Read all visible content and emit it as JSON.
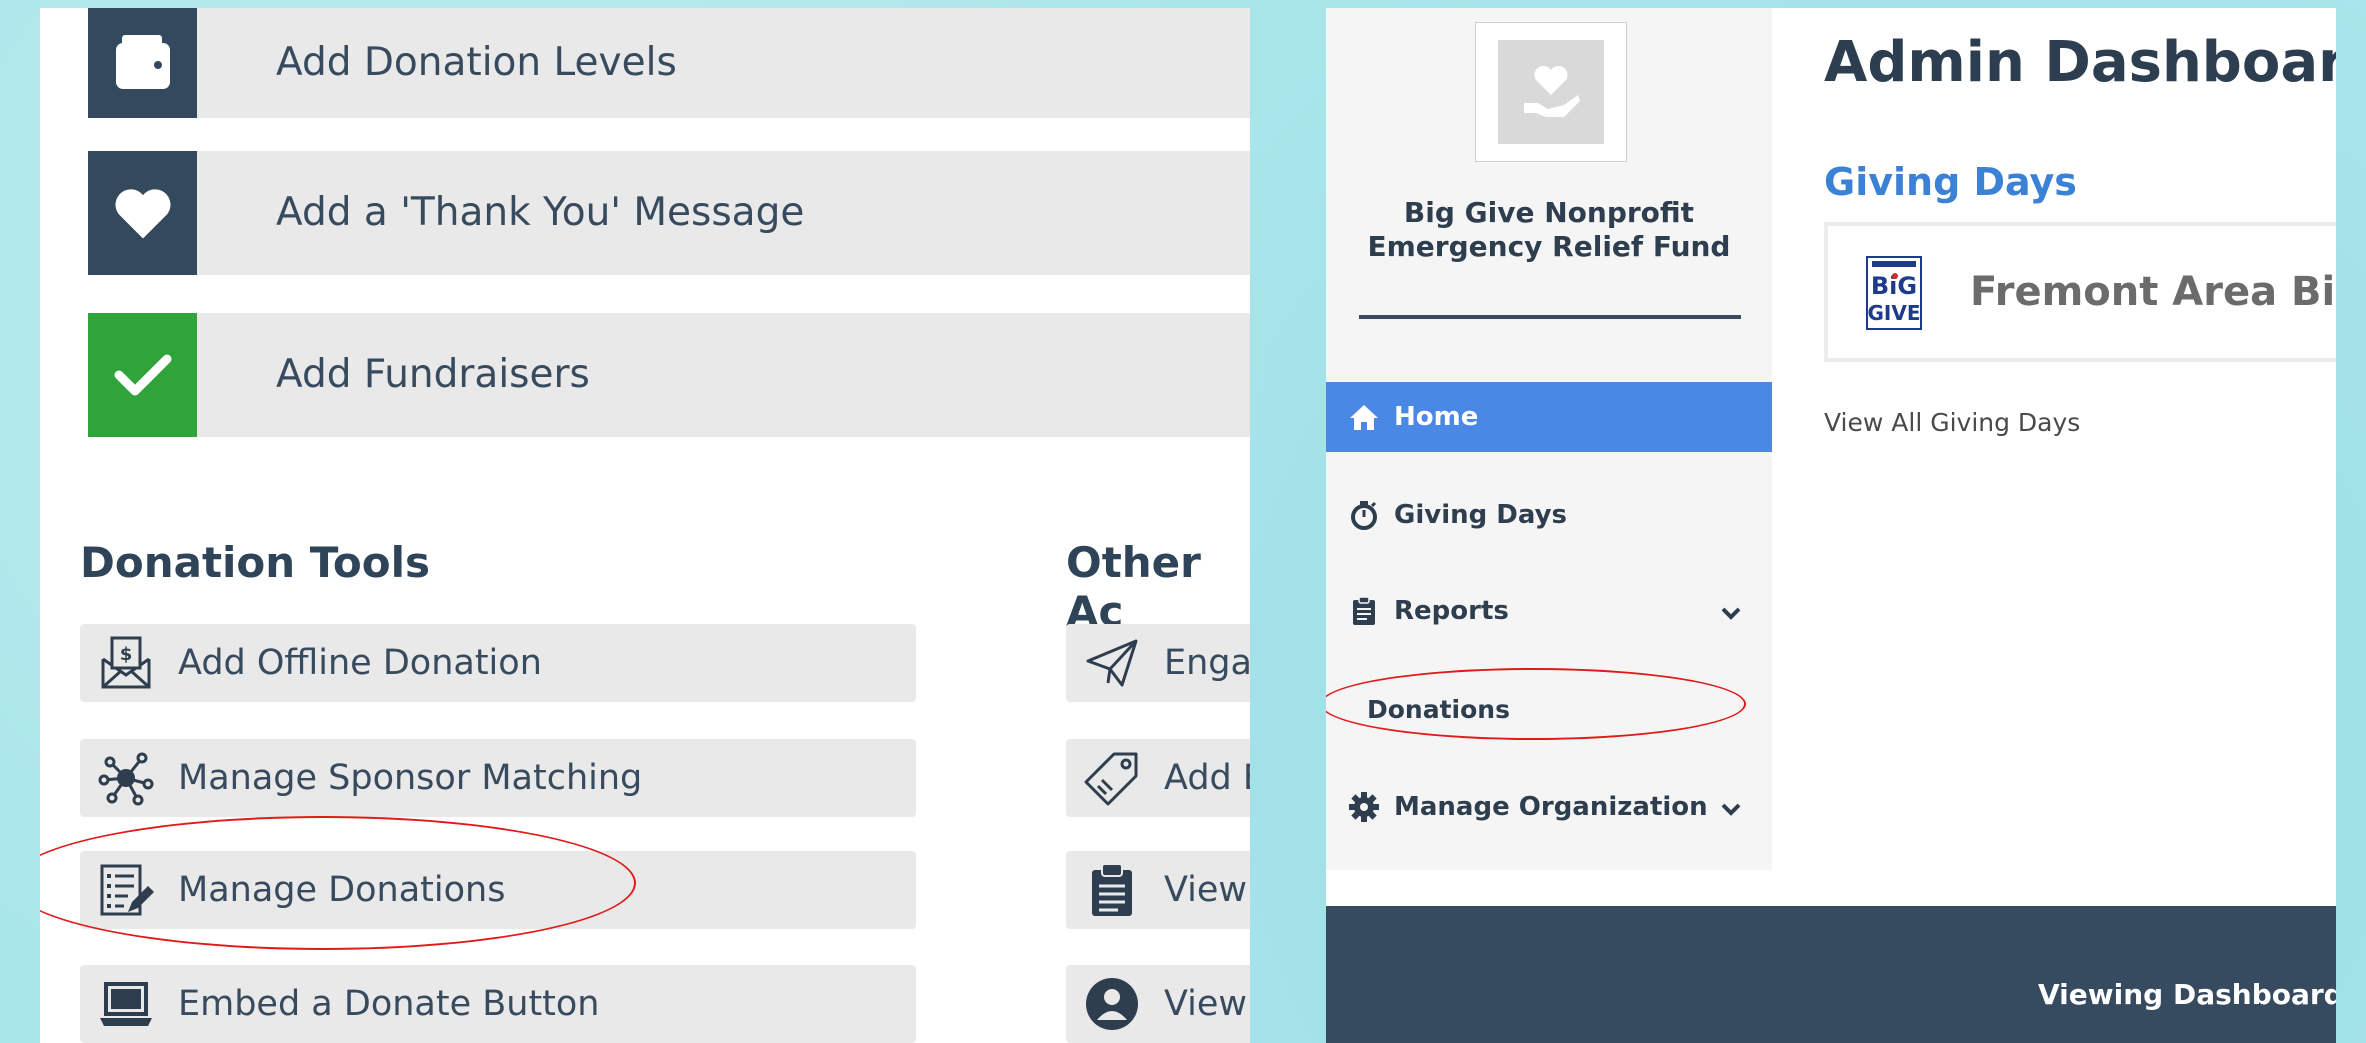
{
  "left": {
    "steps": [
      {
        "label": "Add Donation Levels",
        "icon": "wallet-icon",
        "icon_bg": "#34495e"
      },
      {
        "label": "Add a 'Thank You' Message",
        "icon": "heart-icon",
        "icon_bg": "#34495e"
      },
      {
        "label": "Add Fundraisers",
        "icon": "check-icon",
        "icon_bg": "#2ea43a"
      }
    ],
    "donation_tools": {
      "title": "Donation Tools",
      "items": [
        {
          "label": "Add Offline Donation",
          "icon": "envelope-dollar-icon"
        },
        {
          "label": "Manage Sponsor Matching",
          "icon": "network-icon"
        },
        {
          "label": "Manage Donations",
          "icon": "list-edit-icon"
        },
        {
          "label": "Embed a Donate Button",
          "icon": "laptop-icon"
        }
      ]
    },
    "other_actions": {
      "title": "Other Ac",
      "items": [
        {
          "label": "Engag",
          "icon": "paper-plane-icon"
        },
        {
          "label": "Add B",
          "icon": "tag-icon"
        },
        {
          "label": "View",
          "icon": "clipboard-icon"
        },
        {
          "label": "View",
          "icon": "user-circle-icon"
        }
      ]
    }
  },
  "right": {
    "org_name": "Big Give Nonprofit Emergency Relief Fund",
    "nav": {
      "home": "Home",
      "giving_days": "Giving Days",
      "reports": "Reports",
      "donations": "Donations",
      "manage_org": "Manage Organization"
    },
    "main": {
      "title": "Admin Dashboard",
      "giving_days_heading": "Giving Days",
      "event_name": "Fremont Area Big G",
      "event_logo_text": "BiG GIVE",
      "view_all": "View All Giving Days"
    },
    "footer": {
      "text": "Viewing Dashboard f"
    }
  },
  "colors": {
    "accent_blue": "#4a88e6",
    "heading_blue": "#3b82d6",
    "navy": "#34495e",
    "green": "#2ea43a",
    "annotation_red": "#e01b1b"
  }
}
